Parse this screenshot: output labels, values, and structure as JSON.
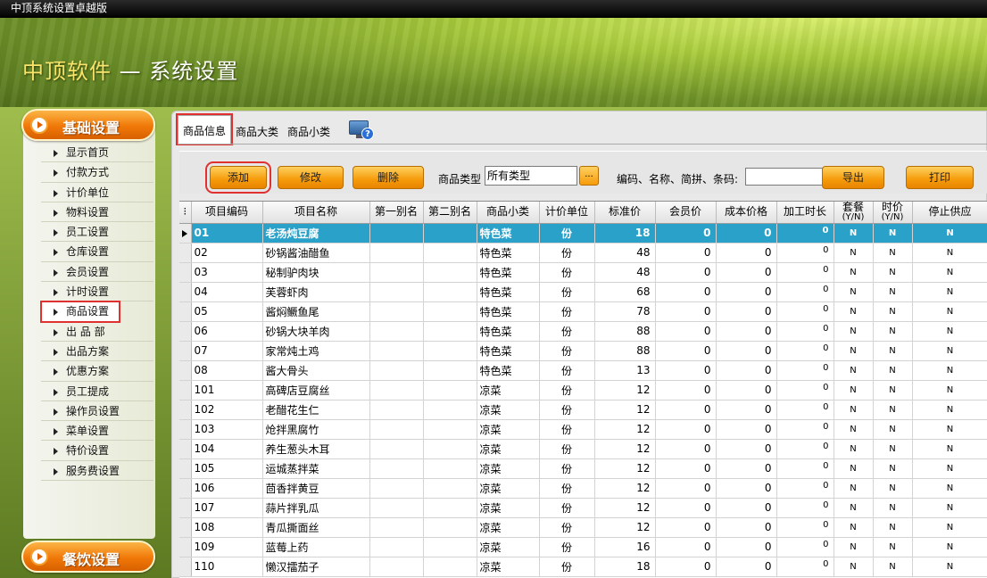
{
  "window": {
    "title": "中顶系统设置卓越版"
  },
  "banner": {
    "brand": "中顶软件",
    "title": "— 系统设置"
  },
  "sidebar": {
    "header_top": "基础设置",
    "header_bottom": "餐饮设置",
    "items": [
      "显示首页",
      "付款方式",
      "计价单位",
      "物料设置",
      "员工设置",
      "仓库设置",
      "会员设置",
      "计时设置",
      "商品设置",
      "出 品 部",
      "出品方案",
      "优惠方案",
      "员工提成",
      "操作员设置",
      "菜单设置",
      "特价设置",
      "服务费设置"
    ],
    "selected": "商品设置"
  },
  "tabs": [
    "商品信息",
    "商品大类",
    "商品小类"
  ],
  "active_tab": "商品信息",
  "toolbar": {
    "add": "添加",
    "edit": "修改",
    "delete": "删除",
    "type_label": "商品类型",
    "type_value": "所有类型",
    "dots": "...",
    "search_label": "编码、名称、简拼、条码:",
    "export": "导出",
    "print": "打印"
  },
  "table": {
    "headers": [
      "项目编码",
      "项目名称",
      "第一别名",
      "第二别名",
      "商品小类",
      "计价单位",
      "标准价",
      "会员价",
      "成本价格",
      "加工时长",
      "套餐(Y/N)",
      "时价(Y/N)",
      "停止供应"
    ],
    "rows": [
      [
        "01",
        "老汤炖豆腐",
        "",
        "",
        "特色菜",
        "份",
        "18",
        "0",
        "0",
        "0",
        "N",
        "N",
        "N"
      ],
      [
        "02",
        "砂锅酱油醋鱼",
        "",
        "",
        "特色菜",
        "份",
        "48",
        "0",
        "0",
        "0",
        "N",
        "N",
        "N"
      ],
      [
        "03",
        "秘制驴肉块",
        "",
        "",
        "特色菜",
        "份",
        "48",
        "0",
        "0",
        "0",
        "N",
        "N",
        "N"
      ],
      [
        "04",
        "芙蓉虾肉",
        "",
        "",
        "特色菜",
        "份",
        "68",
        "0",
        "0",
        "0",
        "N",
        "N",
        "N"
      ],
      [
        "05",
        "酱焖鳜鱼尾",
        "",
        "",
        "特色菜",
        "份",
        "78",
        "0",
        "0",
        "0",
        "N",
        "N",
        "N"
      ],
      [
        "06",
        "砂锅大块羊肉",
        "",
        "",
        "特色菜",
        "份",
        "88",
        "0",
        "0",
        "0",
        "N",
        "N",
        "N"
      ],
      [
        "07",
        "家常炖土鸡",
        "",
        "",
        "特色菜",
        "份",
        "88",
        "0",
        "0",
        "0",
        "N",
        "N",
        "N"
      ],
      [
        "08",
        "酱大骨头",
        "",
        "",
        "特色菜",
        "份",
        "13",
        "0",
        "0",
        "0",
        "N",
        "N",
        "N"
      ],
      [
        "101",
        "高碑店豆腐丝",
        "",
        "",
        "凉菜",
        "份",
        "12",
        "0",
        "0",
        "0",
        "N",
        "N",
        "N"
      ],
      [
        "102",
        "老醋花生仁",
        "",
        "",
        "凉菜",
        "份",
        "12",
        "0",
        "0",
        "0",
        "N",
        "N",
        "N"
      ],
      [
        "103",
        "炝拌黑腐竹",
        "",
        "",
        "凉菜",
        "份",
        "12",
        "0",
        "0",
        "0",
        "N",
        "N",
        "N"
      ],
      [
        "104",
        "养生葱头木耳",
        "",
        "",
        "凉菜",
        "份",
        "12",
        "0",
        "0",
        "0",
        "N",
        "N",
        "N"
      ],
      [
        "105",
        "运城蒸拌菜",
        "",
        "",
        "凉菜",
        "份",
        "12",
        "0",
        "0",
        "0",
        "N",
        "N",
        "N"
      ],
      [
        "106",
        "茴香拌黄豆",
        "",
        "",
        "凉菜",
        "份",
        "12",
        "0",
        "0",
        "0",
        "N",
        "N",
        "N"
      ],
      [
        "107",
        "蒜片拌乳瓜",
        "",
        "",
        "凉菜",
        "份",
        "12",
        "0",
        "0",
        "0",
        "N",
        "N",
        "N"
      ],
      [
        "108",
        "青瓜撕面丝",
        "",
        "",
        "凉菜",
        "份",
        "12",
        "0",
        "0",
        "0",
        "N",
        "N",
        "N"
      ],
      [
        "109",
        "蓝莓上药",
        "",
        "",
        "凉菜",
        "份",
        "16",
        "0",
        "0",
        "0",
        "N",
        "N",
        "N"
      ],
      [
        "110",
        "懒汉擂茄子",
        "",
        "",
        "凉菜",
        "份",
        "18",
        "0",
        "0",
        "0",
        "N",
        "N",
        "N"
      ]
    ],
    "selected_row": 0
  }
}
